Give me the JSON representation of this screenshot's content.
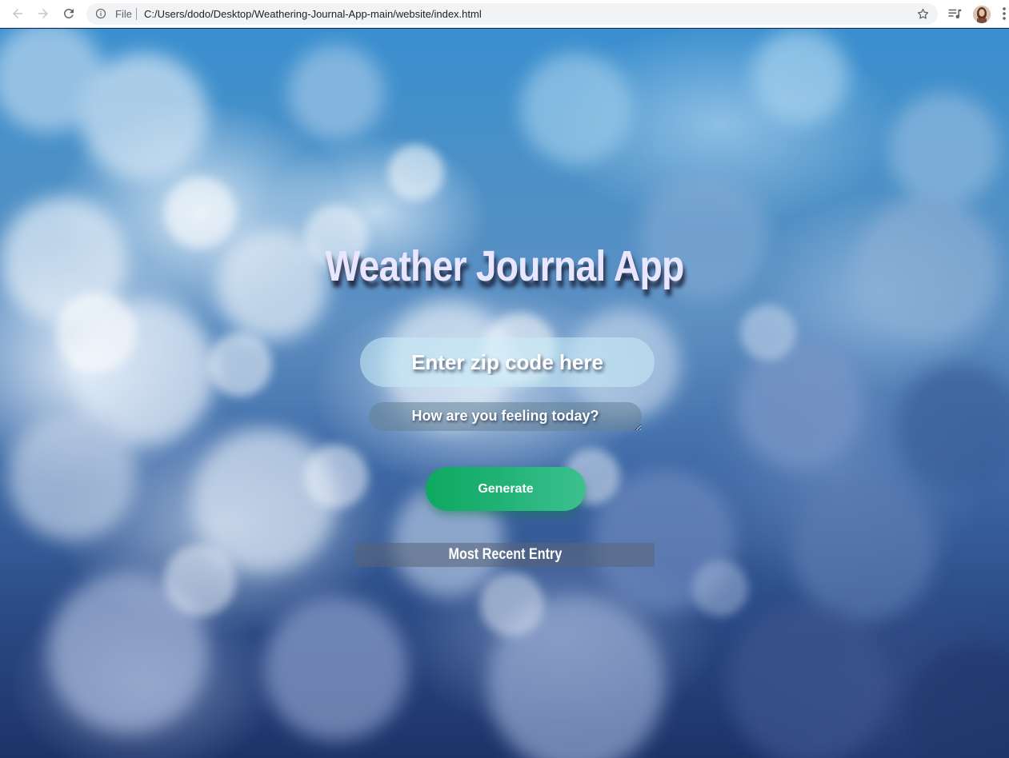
{
  "browser": {
    "scheme_label": "File",
    "url": "C:/Users/dodo/Desktop/Weathering-Journal-App-main/website/index.html",
    "icons": [
      "back-arrow-icon",
      "forward-arrow-icon",
      "reload-icon",
      "info-icon",
      "star-icon",
      "media-control-icon",
      "profile-avatar",
      "kebab-menu-icon"
    ]
  },
  "app": {
    "title": "Weather Journal App",
    "zip_placeholder": "Enter zip code here",
    "feelings_placeholder": "How are you feeling today?",
    "generate_label": "Generate",
    "entry_header": "Most Recent Entry"
  },
  "colors": {
    "title": "#e9e6ff",
    "button_start": "#0ea860",
    "button_end": "#3cc18f",
    "sky_top": "#3a8fcf",
    "sky_bottom": "#1d3368"
  }
}
